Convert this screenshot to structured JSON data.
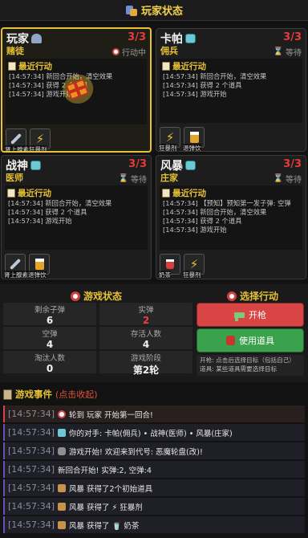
{
  "header": {
    "title": "玩家状态"
  },
  "players": [
    {
      "name": "玩家",
      "hp": "3/3",
      "role": "赌徒",
      "status": "行动中",
      "log_title": "最近行动",
      "log": [
        "[14:57:34] 新回合开始，清空效果",
        "[14:57:34] 获得 2 个道具",
        "[14:57:34] 游戏开始"
      ],
      "items": [
        {
          "icon": "syringe-icon",
          "label": "肾上腺素"
        },
        {
          "icon": "bolt-icon",
          "label": "狂暴剂"
        }
      ]
    },
    {
      "name": "卡帕",
      "hp": "3/3",
      "role": "佣兵",
      "status": "等待",
      "log_title": "最近行动",
      "log": [
        "[14:57:34] 新回合开始，清空效果",
        "[14:57:34] 获得 2 个道具",
        "[14:57:34] 游戏开始"
      ],
      "items": [
        {
          "icon": "bolt-icon",
          "label": "狂暴剂"
        },
        {
          "icon": "beer-icon",
          "label": "退弹饮"
        }
      ]
    },
    {
      "name": "战神",
      "hp": "3/3",
      "role": "医师",
      "status": "等待",
      "log_title": "最近行动",
      "log": [
        "[14:57:34] 新回合开始，清空效果",
        "[14:57:34] 获得 2 个道具",
        "[14:57:34] 游戏开始"
      ],
      "items": [
        {
          "icon": "syringe-icon",
          "label": "肾上腺素"
        },
        {
          "icon": "beer-icon",
          "label": "退弹饮"
        }
      ]
    },
    {
      "name": "风暴",
      "hp": "3/3",
      "role": "庄家",
      "status": "等待",
      "log_title": "最近行动",
      "log": [
        "[14:57:34] 【预知】预知第一发子弹: 空弹",
        "[14:57:34] 新回合开始，清空效果",
        "[14:57:34] 获得 2 个道具",
        "[14:57:34] 游戏开始"
      ],
      "items": [
        {
          "icon": "cup-icon",
          "label": "奶茶"
        },
        {
          "icon": "bolt-icon",
          "label": "狂暴剂"
        }
      ]
    }
  ],
  "game_state": {
    "title": "游戏状态",
    "cells": [
      {
        "k": "剩余子弹",
        "v": "6",
        "red": false
      },
      {
        "k": "实弹",
        "v": "2",
        "red": true
      },
      {
        "k": "空弹",
        "v": "4",
        "red": false
      },
      {
        "k": "存活人数",
        "v": "4",
        "red": false
      },
      {
        "k": "淘汰人数",
        "v": "0",
        "red": false
      },
      {
        "k": "游戏阶段",
        "v": "第2轮",
        "red": false
      }
    ]
  },
  "actions": {
    "title": "选择行动",
    "fire_label": "开枪",
    "use_item_label": "使用道具",
    "hint_line1": "开枪: 点击后选择目标（包括自己）",
    "hint_line2": "道具: 某些道具需要选择目标"
  },
  "events": {
    "title": "游戏事件",
    "toggle_label": "(点击收起)",
    "list": [
      {
        "time": "[14:57:34]",
        "icon": "target",
        "text": "轮到 玩家 开始第一回合!"
      },
      {
        "time": "[14:57:34]",
        "icon": "robot",
        "text": "你的对手: 卡帕(佣兵) • 战神(医师) • 风暴(庄家)"
      },
      {
        "time": "[14:57:34]",
        "icon": "gamepad",
        "text": "游戏开始! 欢迎来到代号: 恶魔轮盘(改)!"
      },
      {
        "time": "[14:57:34]",
        "icon": "none",
        "text": "新回合开始! 实弹:2, 空弹:4"
      },
      {
        "time": "[14:57:34]",
        "icon": "box",
        "text": "风暴 获得了2个初始道具"
      },
      {
        "time": "[14:57:34]",
        "icon": "box",
        "text": "风暴 获得了 ⚡ 狂暴剂"
      },
      {
        "time": "[14:57:34]",
        "icon": "box",
        "text": "风暴 获得了 🥤 奶茶"
      }
    ]
  }
}
